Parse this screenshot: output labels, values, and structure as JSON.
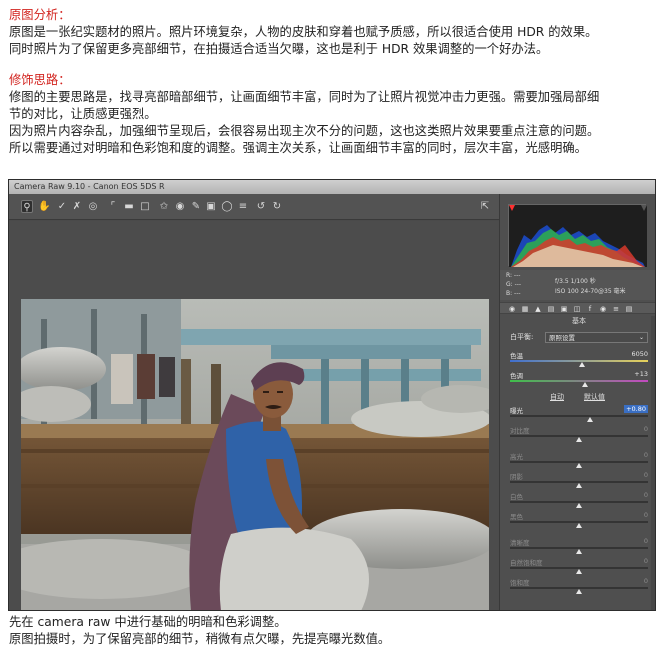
{
  "intro": {
    "heading": "原图分析：",
    "lines": [
      "原图是一张纪实题材的照片。照片环境复杂，人物的皮肤和穿着也赋予质感，所以很适合使用 HDR 的效果。",
      "同时照片为了保留更多亮部细节，在拍摄适合适当欠曝，这也是利于 HDR 效果调整的一个好办法。"
    ]
  },
  "method": {
    "heading": "修饰思路：",
    "lines": [
      "修图的主要思路是，找寻亮部暗部细节，让画面细节丰富，同时为了让照片视觉冲击力更强。需要加强局部细",
      "节的对比，让质感更强烈。",
      "因为照片内容杂乱，加强细节呈现后，会很容易出现主次不分的问题，这也这类照片效果要重点注意的问题。",
      "所以需要通过对明暗和色彩饱和度的调整。强调主次关系，让画面细节丰富的同时，层次丰富，光感明确。"
    ]
  },
  "footer": {
    "lines": [
      "先在 camera raw 中进行基础的明暗和色彩调整。",
      "原图拍摄时，为了保留亮部的细节，稍微有点欠曝，先提亮曝光数值。"
    ]
  },
  "camera_raw": {
    "title": "Camera Raw 9.10 -  Canon EOS 5DS R",
    "info": {
      "rgb_labels": [
        "R:  ---",
        "G:  ---",
        "B:  ---"
      ],
      "exposure": "f/3.5   1/100 秒",
      "iso_lens": "ISO 100   24-70@35 毫米"
    },
    "panel_title": "基本",
    "white_balance": {
      "label": "白平衡:",
      "value": "原照设置"
    },
    "temp": {
      "label": "色温",
      "value": "6050"
    },
    "tint": {
      "label": "色调",
      "value": "+13"
    },
    "auto_label": "自动",
    "default_label": "默认值",
    "sliders": [
      {
        "label": "曝光",
        "value": "+0.80",
        "fraction": 0.58
      },
      {
        "label": "对比度",
        "value": "0",
        "fraction": 0.5
      },
      {
        "label": "高光",
        "value": "0",
        "fraction": 0.5
      },
      {
        "label": "阴影",
        "value": "0",
        "fraction": 0.5
      },
      {
        "label": "白色",
        "value": "0",
        "fraction": 0.5
      },
      {
        "label": "黑色",
        "value": "0",
        "fraction": 0.5
      },
      {
        "label": "清晰度",
        "value": "0",
        "fraction": 0.5
      },
      {
        "label": "自然饱和度",
        "value": "0",
        "fraction": 0.5
      },
      {
        "label": "饱和度",
        "value": "0",
        "fraction": 0.5
      }
    ]
  }
}
